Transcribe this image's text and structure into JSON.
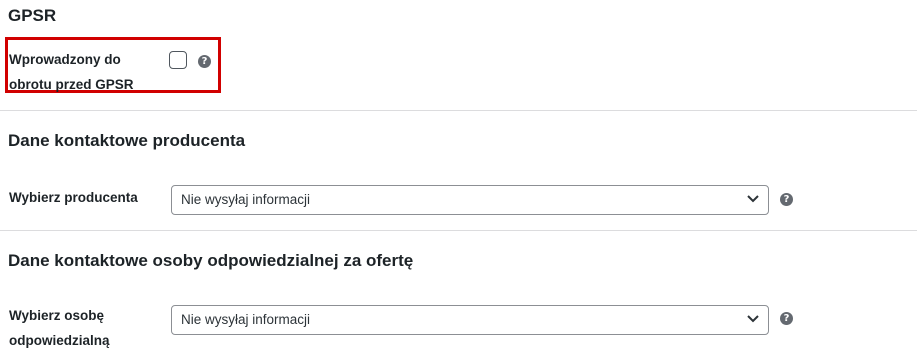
{
  "gpsr": {
    "title": "GPSR",
    "checkbox_label_line1": "Wprowadzony do",
    "checkbox_label_line2": "obrotu przed GPSR",
    "checkbox_checked": false
  },
  "manufacturer": {
    "title": "Dane kontaktowe producenta",
    "label": "Wybierz producenta",
    "selected": "Nie wysyłaj informacji"
  },
  "responsible": {
    "title": "Dane kontaktowe osoby odpowiedzialnej za ofertę",
    "label_line1": "Wybierz osobę",
    "label_line2": "odpowiedzialną",
    "selected": "Nie wysyłaj informacji"
  },
  "help_glyph": "?",
  "colors": {
    "highlight": "#d10000",
    "help_icon": "#646970",
    "text": "#1d2327"
  }
}
